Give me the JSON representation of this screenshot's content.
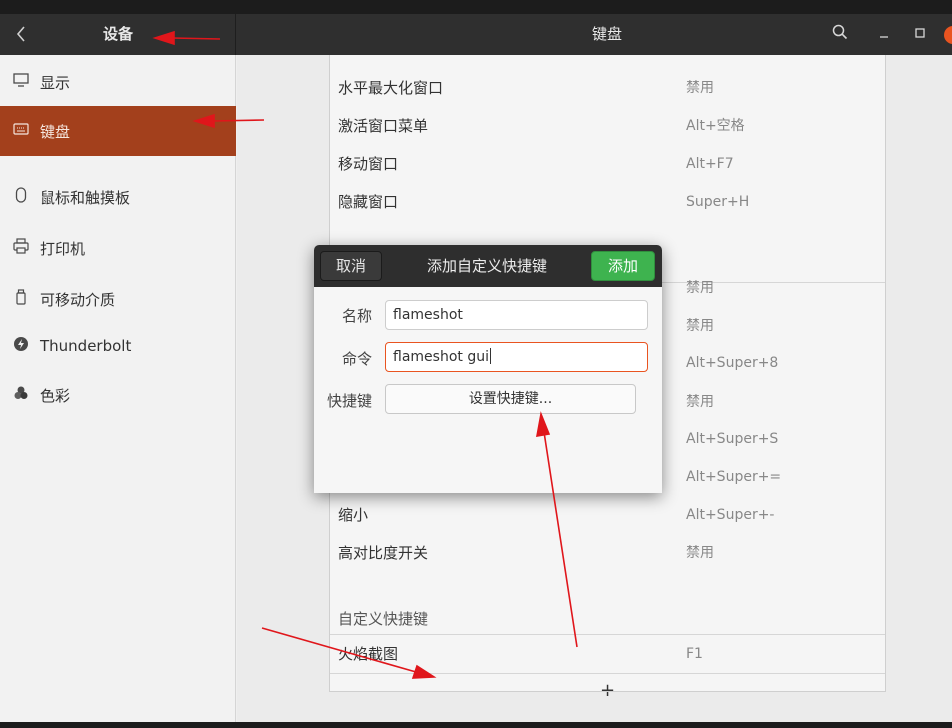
{
  "header": {
    "left_title": "设备",
    "main_title": "键盘"
  },
  "sidebar": {
    "items": [
      {
        "label": "显示",
        "icon": "display-icon"
      },
      {
        "label": "键盘",
        "icon": "keyboard-icon",
        "selected": true
      },
      {
        "label": "鼠标和触摸板",
        "icon": "mouse-icon"
      },
      {
        "label": "打印机",
        "icon": "printer-icon"
      },
      {
        "label": "可移动介质",
        "icon": "removable-media-icon"
      },
      {
        "label": "Thunderbolt",
        "icon": "thunderbolt-icon"
      },
      {
        "label": "色彩",
        "icon": "color-icon"
      }
    ]
  },
  "shortcuts": {
    "rows": [
      {
        "name": "水平最大化窗口",
        "value": "禁用"
      },
      {
        "name": "激活窗口菜单",
        "value": "Alt+空格"
      },
      {
        "name": "移动窗口",
        "value": "Alt+F7"
      },
      {
        "name": "隐藏窗口",
        "value": "Super+H"
      },
      {
        "name": "",
        "value": "禁用"
      },
      {
        "name": "",
        "value": "禁用"
      },
      {
        "name": "",
        "value": "Alt+Super+8"
      },
      {
        "name": "",
        "value": "禁用"
      },
      {
        "name": "",
        "value": "Alt+Super+S"
      },
      {
        "name": "",
        "value": "Alt+Super+="
      },
      {
        "name": "缩小",
        "value": "Alt+Super+-"
      },
      {
        "name": "高对比度开关",
        "value": "禁用"
      }
    ],
    "custom_section_label": "自定义快捷键",
    "custom_rows": [
      {
        "name": "火焰截图",
        "value": "F1"
      }
    ],
    "add_label": "+"
  },
  "dialog": {
    "title": "添加自定义快捷键",
    "cancel_label": "取消",
    "add_label": "添加",
    "name_label": "名称",
    "name_value": "flameshot",
    "command_label": "命令",
    "command_value": "flameshot gui",
    "shortcut_label": "快捷键",
    "shortcut_button": "设置快捷键..."
  },
  "colors": {
    "accent": "#e95420",
    "selected_sidebar": "#a3401c",
    "add_button": "#3eb34f",
    "annotation_arrow": "#e0161b"
  }
}
